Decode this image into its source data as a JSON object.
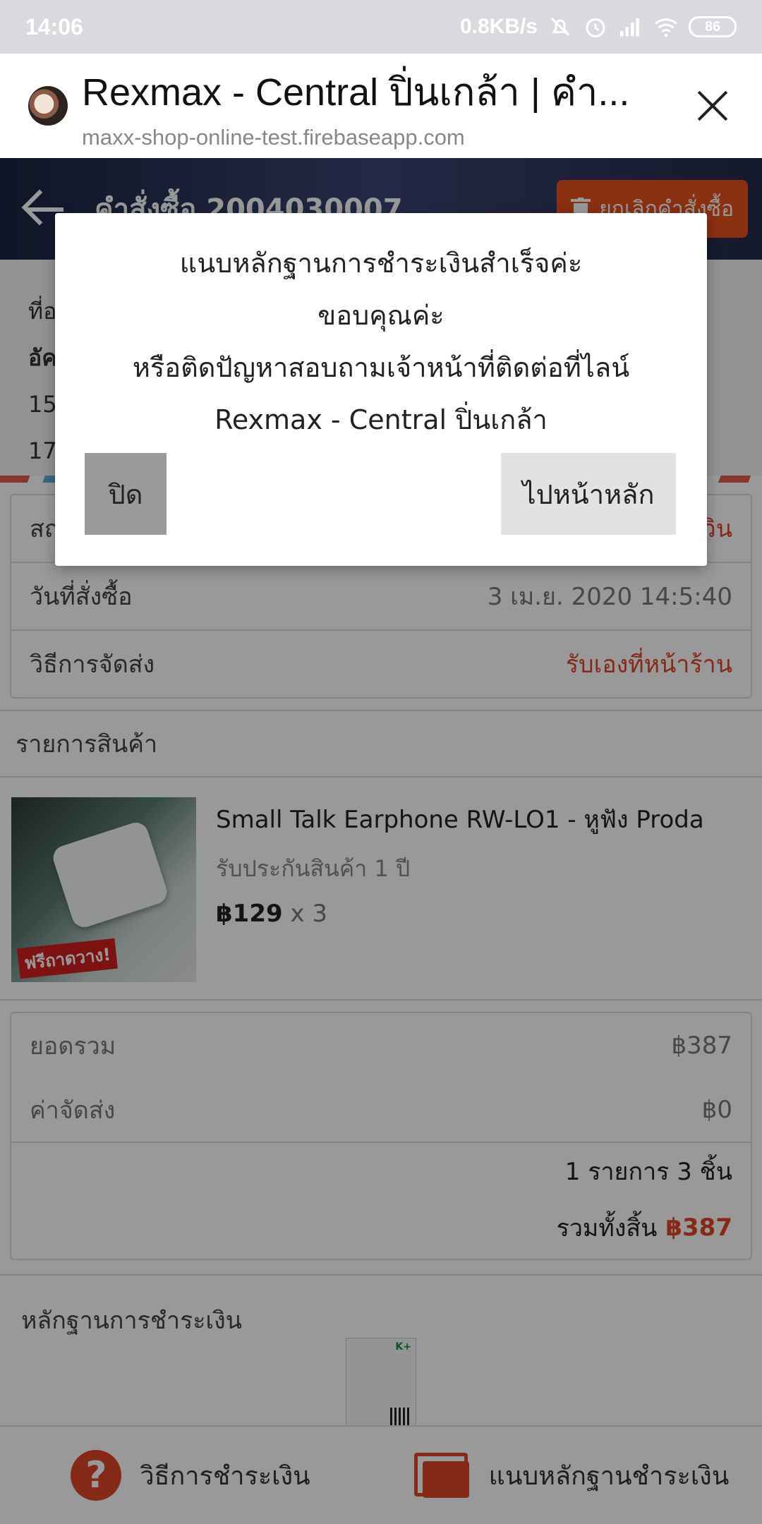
{
  "status_bar": {
    "time": "14:06",
    "speed": "0.8KB/s",
    "battery": "86"
  },
  "browser": {
    "title": "Rexmax - Central ปิ่นเกล้า | คำ...",
    "url": "maxx-shop-online-test.firebaseapp.com"
  },
  "header": {
    "title": "คำสั่งซื้อ 2004030007",
    "cancel_label": "ยกเลิกคำสั่งซื้อ"
  },
  "address": {
    "line1": "ที่อ",
    "line2": "อัค",
    "line3": "15",
    "line4": "17"
  },
  "order_info": {
    "status_label": "สถ",
    "status_value": "วิน",
    "date_label": "วันที่สั่งซื้อ",
    "date_value": "3 เม.ย. 2020 14:5:40",
    "shipping_label": "วิธีการจัดส่ง",
    "shipping_value": "รับเองที่หน้าร้าน"
  },
  "products": {
    "header": "รายการสินค้า",
    "items": [
      {
        "name": "Small Talk Earphone RW-LO1 - หูฟัง Proda",
        "warranty": "รับประกันสินค้า 1 ปี",
        "price": "฿129",
        "qty": "x 3",
        "promo": "ฟรีถาดวาง!"
      }
    ]
  },
  "summary": {
    "subtotal_label": "ยอดรวม",
    "subtotal_value": "฿387",
    "shipping_label": "ค่าจัดส่ง",
    "shipping_value": "฿0",
    "count_text": "1 รายการ 3 ชิ้น",
    "total_label": "รวมทั้งสิ้น",
    "total_value": "฿387"
  },
  "proof": {
    "header": "หลักฐานการชำระเงิน",
    "slip_brand": "K+"
  },
  "bottom_bar": {
    "payment_method": "วิธีการชำระเงิน",
    "attach_proof": "แนบหลักฐานชำระเงิน"
  },
  "dialog": {
    "line1": "แนบหลักฐานการชำระเงินสำเร็จค่ะ",
    "line2": "ขอบคุณค่ะ",
    "line3": "หรือติดปัญหาสอบถามเจ้าหน้าที่ติดต่อที่ไลน์",
    "line4": "Rexmax - Central ปิ่นเกล้า",
    "close_label": "ปิด",
    "home_label": "ไปหน้าหลัก"
  },
  "colors": {
    "accent": "#e0452a",
    "header_bg": "#2a3358",
    "overlay": "rgba(0,0,0,0.4)"
  }
}
